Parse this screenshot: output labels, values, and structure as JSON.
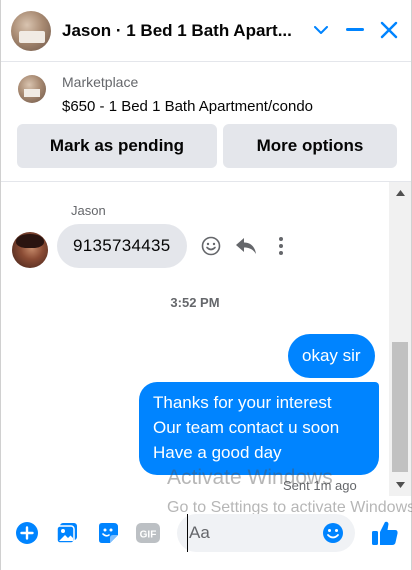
{
  "header": {
    "title": "Jason · 1 Bed 1 Bath Apart...",
    "accent_color": "#0084ff"
  },
  "listing": {
    "source": "Marketplace",
    "title": "$650 - 1 Bed 1 Bath Apartment/condo",
    "buttons": {
      "mark_pending": "Mark as pending",
      "more_options": "More options"
    }
  },
  "conversation": {
    "sender_name": "Jason",
    "incoming_message": "9135734435",
    "timestamp": "3:52 PM",
    "outgoing_messages": [
      {
        "lines": [
          "okay sir"
        ]
      },
      {
        "lines": [
          "Thanks for your interest",
          "Our team contact u soon",
          "Have a good day"
        ]
      }
    ],
    "status": "Sent 1m ago",
    "outgoing_bubble_color": "#0084ff",
    "incoming_bubble_color": "#e4e6eb"
  },
  "watermark": {
    "title": "Activate Windows",
    "subtitle": "Go to Settings to activate Windows."
  },
  "composer": {
    "placeholder": "Aa",
    "icons": [
      "plus-icon",
      "image-icon",
      "sticker-icon",
      "gif-icon",
      "emoji-icon",
      "thumbs-up-icon"
    ],
    "gif_label": "GIF"
  }
}
